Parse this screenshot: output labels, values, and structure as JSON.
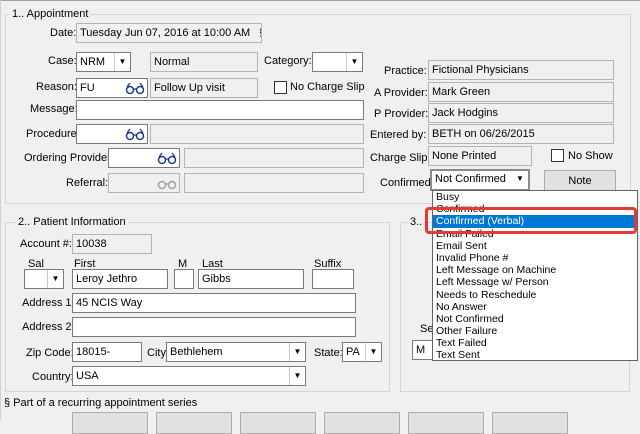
{
  "appointment": {
    "title": "1.. Appointment",
    "date_label": "Date:",
    "date_value": "Tuesday Jun 07, 2016 at 10:00 AM",
    "date_symbol": "§",
    "case_label": "Case:",
    "case_value": "NRM",
    "case_desc": "Normal",
    "category_label": "Category:",
    "category_value": "",
    "reason_label": "Reason:",
    "reason_value": "FU",
    "reason_desc": "Follow Up visit",
    "no_charge_label": "No Charge Slip",
    "message_label": "Message:",
    "message_value": "",
    "procedure_label": "Procedure:",
    "procedure_value": "",
    "ordering_label": "Ordering Provider:",
    "ordering_value": "",
    "referral_label": "Referral:",
    "referral_value": "",
    "practice_label": "Practice:",
    "practice_value": "Fictional Physicians",
    "a_provider_label": "A Provider:",
    "a_provider_value": "Mark  Green",
    "p_provider_label": "P Provider:",
    "p_provider_value": "Jack Hodgins",
    "entered_label": "Entered by:",
    "entered_value": "BETH on 06/26/2015",
    "charge_slip_label": "Charge Slip:",
    "charge_slip_value": "None Printed",
    "no_show_label": "No Show",
    "confirmed_label": "Confirmed:",
    "confirmed_value": "Not Confirmed",
    "note_button": "Note"
  },
  "confirm_options": [
    "Busy",
    "Confirmed",
    "Confirmed (Verbal)",
    "Email Failed",
    "Email Sent",
    "Invalid Phone #",
    "Left Message on Machine",
    "Left Message w/ Person",
    "Needs to Reschedule",
    "No Answer",
    "Not Confirmed",
    "Other Failure",
    "Text Failed",
    "Text Sent"
  ],
  "patient": {
    "title": "2.. Patient Information",
    "account_label": "Account #:",
    "account_value": "10038",
    "sal_label": "Sal",
    "first_label": "First",
    "m_label": "M",
    "last_label": "Last",
    "suffix_label": "Suffix",
    "sal_value": "",
    "first_value": "Leroy Jethro",
    "m_value": "",
    "last_value": "Gibbs",
    "suffix_value": "",
    "address1_label": "Address 1:",
    "address1_value": "45 NCIS Way",
    "address2_label": "Address 2:",
    "address2_value": "",
    "zip_label": "Zip Code:",
    "zip_value": "18015-",
    "city_label": "City:",
    "city_value": "Bethlehem",
    "state_label": "State:",
    "state_value": "PA",
    "country_label": "Country:",
    "country_value": "USA"
  },
  "section3": {
    "title_fragment": "3..",
    "se_fragment": "Se",
    "m_fragment": "M"
  },
  "footer": {
    "recurring_note": "§  Part of a recurring appointment series"
  }
}
